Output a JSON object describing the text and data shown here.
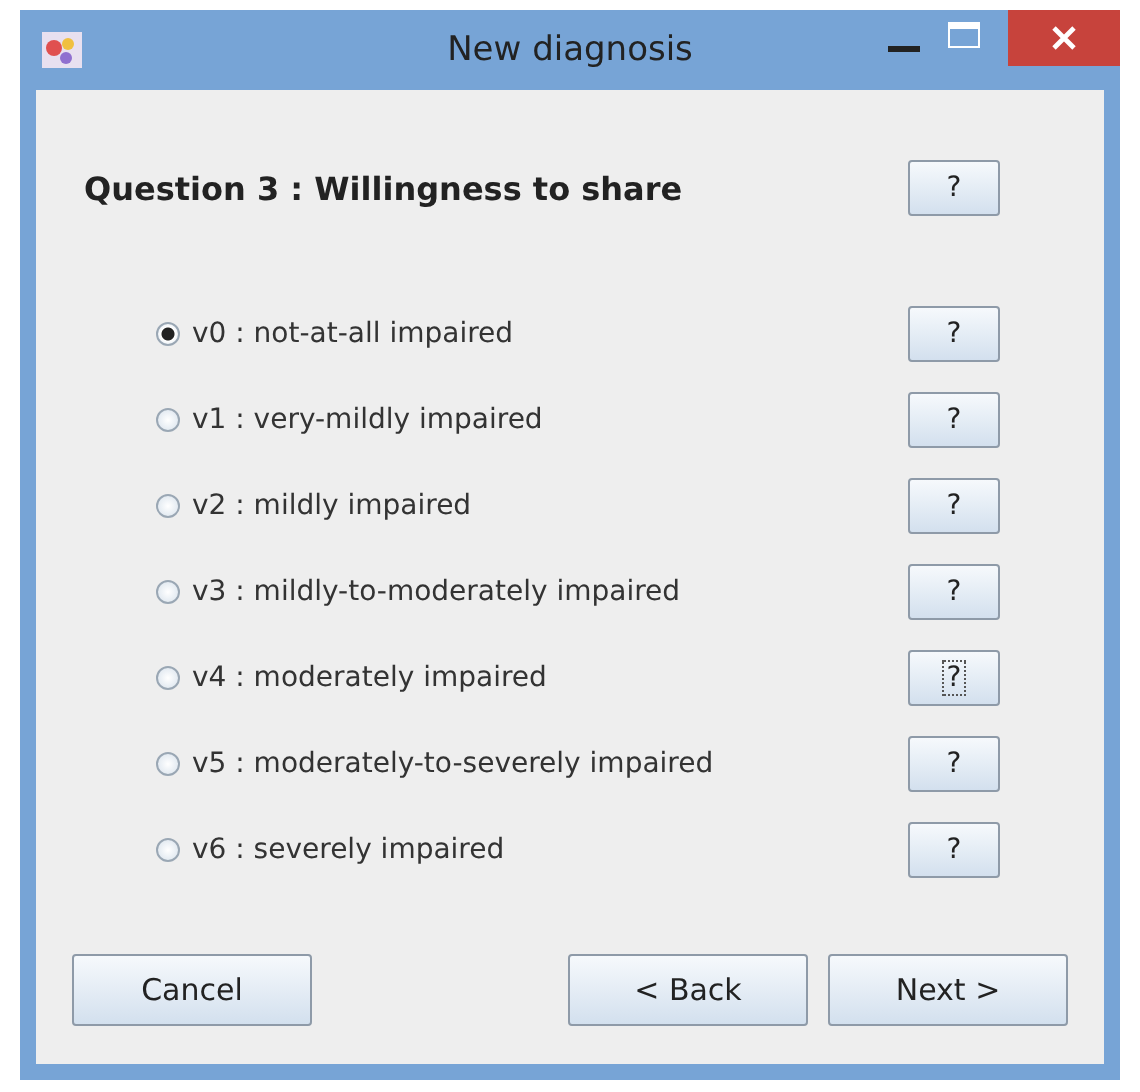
{
  "window": {
    "title": "New diagnosis"
  },
  "question": {
    "title": "Question 3 : Willingness to share",
    "help": "?"
  },
  "options": [
    {
      "label": "v0 : not-at-all impaired",
      "selected": true,
      "help": "?",
      "focused": false
    },
    {
      "label": "v1 : very-mildly impaired",
      "selected": false,
      "help": "?",
      "focused": false
    },
    {
      "label": "v2 : mildly impaired",
      "selected": false,
      "help": "?",
      "focused": false
    },
    {
      "label": "v3 : mildly-to-moderately impaired",
      "selected": false,
      "help": "?",
      "focused": false
    },
    {
      "label": "v4 : moderately impaired",
      "selected": false,
      "help": "?",
      "focused": true
    },
    {
      "label": "v5 : moderately-to-severely impaired",
      "selected": false,
      "help": "?",
      "focused": false
    },
    {
      "label": "v6 : severely impaired",
      "selected": false,
      "help": "?",
      "focused": false
    }
  ],
  "buttons": {
    "cancel": "Cancel",
    "back": "< Back",
    "next": "Next >"
  }
}
